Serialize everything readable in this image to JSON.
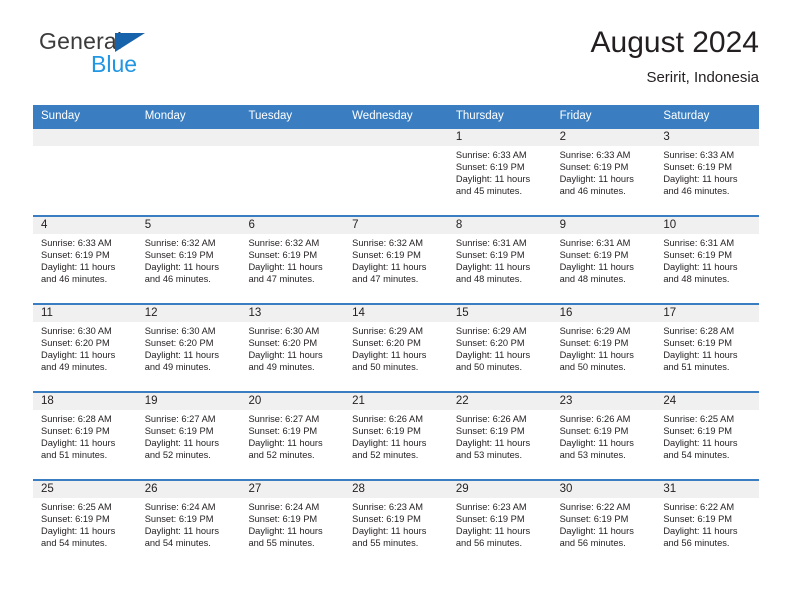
{
  "brand": {
    "name_part1": "General",
    "name_part2": "Blue",
    "triangle_color": "#1763ab",
    "blue_color": "#2196e3"
  },
  "header": {
    "title": "August 2024",
    "subtitle": "Seririt, Indonesia"
  },
  "theme": {
    "header_blue": "#3a7ec1",
    "day_band_gray": "#f0f0f0",
    "text": "#231f20"
  },
  "weekdays": [
    "Sunday",
    "Monday",
    "Tuesday",
    "Wednesday",
    "Thursday",
    "Friday",
    "Saturday"
  ],
  "labels": {
    "sunrise": "Sunrise:",
    "sunset": "Sunset:",
    "daylight": "Daylight:"
  },
  "weeks": [
    [
      {
        "day": "",
        "sunrise": "",
        "sunset": "",
        "daylight": "",
        "empty": true
      },
      {
        "day": "",
        "sunrise": "",
        "sunset": "",
        "daylight": "",
        "empty": true
      },
      {
        "day": "",
        "sunrise": "",
        "sunset": "",
        "daylight": "",
        "empty": true
      },
      {
        "day": "",
        "sunrise": "",
        "sunset": "",
        "daylight": "",
        "empty": true
      },
      {
        "day": "1",
        "sunrise": "Sunrise: 6:33 AM",
        "sunset": "Sunset: 6:19 PM",
        "daylight": "Daylight: 11 hours and 45 minutes."
      },
      {
        "day": "2",
        "sunrise": "Sunrise: 6:33 AM",
        "sunset": "Sunset: 6:19 PM",
        "daylight": "Daylight: 11 hours and 46 minutes."
      },
      {
        "day": "3",
        "sunrise": "Sunrise: 6:33 AM",
        "sunset": "Sunset: 6:19 PM",
        "daylight": "Daylight: 11 hours and 46 minutes."
      }
    ],
    [
      {
        "day": "4",
        "sunrise": "Sunrise: 6:33 AM",
        "sunset": "Sunset: 6:19 PM",
        "daylight": "Daylight: 11 hours and 46 minutes."
      },
      {
        "day": "5",
        "sunrise": "Sunrise: 6:32 AM",
        "sunset": "Sunset: 6:19 PM",
        "daylight": "Daylight: 11 hours and 46 minutes."
      },
      {
        "day": "6",
        "sunrise": "Sunrise: 6:32 AM",
        "sunset": "Sunset: 6:19 PM",
        "daylight": "Daylight: 11 hours and 47 minutes."
      },
      {
        "day": "7",
        "sunrise": "Sunrise: 6:32 AM",
        "sunset": "Sunset: 6:19 PM",
        "daylight": "Daylight: 11 hours and 47 minutes."
      },
      {
        "day": "8",
        "sunrise": "Sunrise: 6:31 AM",
        "sunset": "Sunset: 6:19 PM",
        "daylight": "Daylight: 11 hours and 48 minutes."
      },
      {
        "day": "9",
        "sunrise": "Sunrise: 6:31 AM",
        "sunset": "Sunset: 6:19 PM",
        "daylight": "Daylight: 11 hours and 48 minutes."
      },
      {
        "day": "10",
        "sunrise": "Sunrise: 6:31 AM",
        "sunset": "Sunset: 6:19 PM",
        "daylight": "Daylight: 11 hours and 48 minutes."
      }
    ],
    [
      {
        "day": "11",
        "sunrise": "Sunrise: 6:30 AM",
        "sunset": "Sunset: 6:20 PM",
        "daylight": "Daylight: 11 hours and 49 minutes."
      },
      {
        "day": "12",
        "sunrise": "Sunrise: 6:30 AM",
        "sunset": "Sunset: 6:20 PM",
        "daylight": "Daylight: 11 hours and 49 minutes."
      },
      {
        "day": "13",
        "sunrise": "Sunrise: 6:30 AM",
        "sunset": "Sunset: 6:20 PM",
        "daylight": "Daylight: 11 hours and 49 minutes."
      },
      {
        "day": "14",
        "sunrise": "Sunrise: 6:29 AM",
        "sunset": "Sunset: 6:20 PM",
        "daylight": "Daylight: 11 hours and 50 minutes."
      },
      {
        "day": "15",
        "sunrise": "Sunrise: 6:29 AM",
        "sunset": "Sunset: 6:20 PM",
        "daylight": "Daylight: 11 hours and 50 minutes."
      },
      {
        "day": "16",
        "sunrise": "Sunrise: 6:29 AM",
        "sunset": "Sunset: 6:19 PM",
        "daylight": "Daylight: 11 hours and 50 minutes."
      },
      {
        "day": "17",
        "sunrise": "Sunrise: 6:28 AM",
        "sunset": "Sunset: 6:19 PM",
        "daylight": "Daylight: 11 hours and 51 minutes."
      }
    ],
    [
      {
        "day": "18",
        "sunrise": "Sunrise: 6:28 AM",
        "sunset": "Sunset: 6:19 PM",
        "daylight": "Daylight: 11 hours and 51 minutes."
      },
      {
        "day": "19",
        "sunrise": "Sunrise: 6:27 AM",
        "sunset": "Sunset: 6:19 PM",
        "daylight": "Daylight: 11 hours and 52 minutes."
      },
      {
        "day": "20",
        "sunrise": "Sunrise: 6:27 AM",
        "sunset": "Sunset: 6:19 PM",
        "daylight": "Daylight: 11 hours and 52 minutes."
      },
      {
        "day": "21",
        "sunrise": "Sunrise: 6:26 AM",
        "sunset": "Sunset: 6:19 PM",
        "daylight": "Daylight: 11 hours and 52 minutes."
      },
      {
        "day": "22",
        "sunrise": "Sunrise: 6:26 AM",
        "sunset": "Sunset: 6:19 PM",
        "daylight": "Daylight: 11 hours and 53 minutes."
      },
      {
        "day": "23",
        "sunrise": "Sunrise: 6:26 AM",
        "sunset": "Sunset: 6:19 PM",
        "daylight": "Daylight: 11 hours and 53 minutes."
      },
      {
        "day": "24",
        "sunrise": "Sunrise: 6:25 AM",
        "sunset": "Sunset: 6:19 PM",
        "daylight": "Daylight: 11 hours and 54 minutes."
      }
    ],
    [
      {
        "day": "25",
        "sunrise": "Sunrise: 6:25 AM",
        "sunset": "Sunset: 6:19 PM",
        "daylight": "Daylight: 11 hours and 54 minutes."
      },
      {
        "day": "26",
        "sunrise": "Sunrise: 6:24 AM",
        "sunset": "Sunset: 6:19 PM",
        "daylight": "Daylight: 11 hours and 54 minutes."
      },
      {
        "day": "27",
        "sunrise": "Sunrise: 6:24 AM",
        "sunset": "Sunset: 6:19 PM",
        "daylight": "Daylight: 11 hours and 55 minutes."
      },
      {
        "day": "28",
        "sunrise": "Sunrise: 6:23 AM",
        "sunset": "Sunset: 6:19 PM",
        "daylight": "Daylight: 11 hours and 55 minutes."
      },
      {
        "day": "29",
        "sunrise": "Sunrise: 6:23 AM",
        "sunset": "Sunset: 6:19 PM",
        "daylight": "Daylight: 11 hours and 56 minutes."
      },
      {
        "day": "30",
        "sunrise": "Sunrise: 6:22 AM",
        "sunset": "Sunset: 6:19 PM",
        "daylight": "Daylight: 11 hours and 56 minutes."
      },
      {
        "day": "31",
        "sunrise": "Sunrise: 6:22 AM",
        "sunset": "Sunset: 6:19 PM",
        "daylight": "Daylight: 11 hours and 56 minutes."
      }
    ]
  ]
}
